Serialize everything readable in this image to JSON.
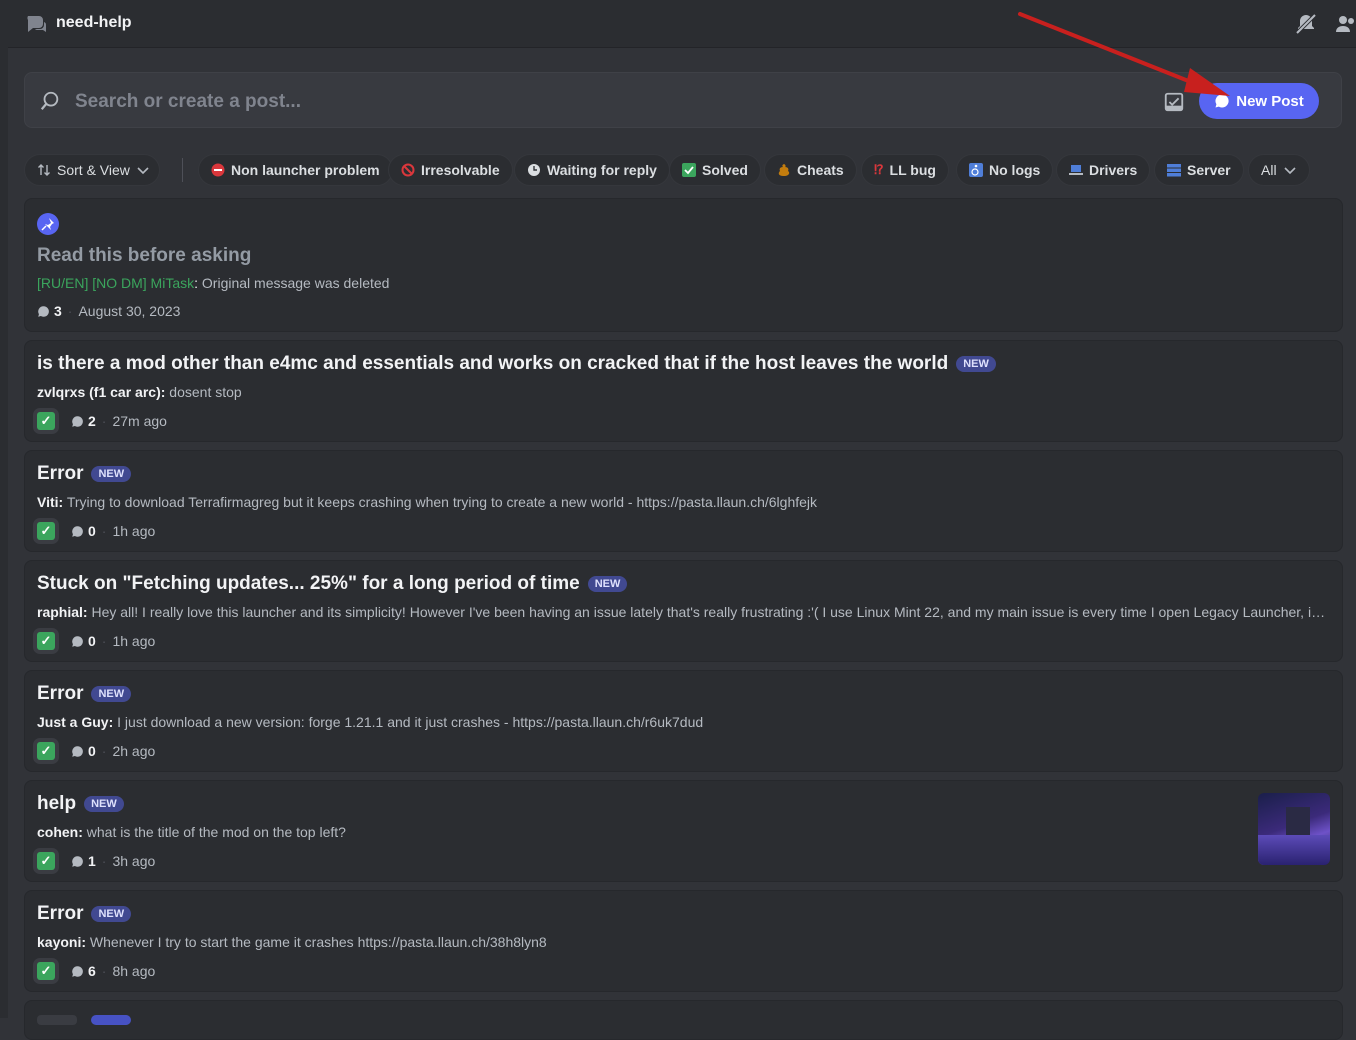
{
  "header": {
    "title": "need-help"
  },
  "search": {
    "placeholder": "Search or create a post...",
    "new_post_label": "New Post"
  },
  "tags": [
    {
      "label": "Sort & View",
      "icon": "sort-icon"
    },
    {
      "label": "Non launcher problem",
      "icon": "no-entry-icon",
      "color": "#da373c"
    },
    {
      "label": "Irresolvable",
      "icon": "prohibited-icon",
      "color": "#da373c"
    },
    {
      "label": "Waiting for reply",
      "icon": "clock-icon",
      "color": "#dbdee1"
    },
    {
      "label": "Solved",
      "icon": "check-icon",
      "color": "#3ba55d"
    },
    {
      "label": "Cheats",
      "icon": "poop-icon",
      "color": "#c27c0e"
    },
    {
      "label": "LL bug",
      "icon": "interrobang-icon",
      "color": "#da373c"
    },
    {
      "label": "No logs",
      "icon": "wheelchair-icon",
      "color": "#4f7ed8"
    },
    {
      "label": "Drivers",
      "icon": "laptop-icon",
      "color": "#4f7ed8"
    },
    {
      "label": "Server",
      "icon": "server-icon",
      "color": "#4f7ed8"
    },
    {
      "label": "All",
      "icon": "chevron-down-icon"
    }
  ],
  "posts": [
    {
      "title": "Read this before asking",
      "new": "",
      "author": "[RU/EN] [NO DM] MiTask",
      "message": "Original message was deleted",
      "replies": "3",
      "time": "August 30, 2023",
      "pinned": true
    },
    {
      "title": "is there a mod other than e4mc and essentials and works on cracked that if the host leaves the world",
      "new": "NEW",
      "author": "zvlqrxs (f1 car arc):",
      "message": "dosent stop",
      "replies": "2",
      "time": "27m ago"
    },
    {
      "title": "Error",
      "new": "NEW",
      "author": "Viti:",
      "message": "Trying to download Terrafirmagreg but it keeps crashing when trying to create a new world - https://pasta.llaun.ch/6lghfejk",
      "replies": "0",
      "time": "1h ago"
    },
    {
      "title": "Stuck on \"Fetching updates... 25%\" for a long period of time",
      "new": "NEW",
      "author": "raphial:",
      "message": "Hey all! I really love this launcher and its simplicity! However I've been having an issue lately that's really frustrating :'( I use Linux Mint 22, and my main issue is every time I open Legacy Launcher, it hangs at ...",
      "replies": "0",
      "time": "1h ago"
    },
    {
      "title": "Error",
      "new": "NEW",
      "author": "Just a Guy:",
      "message": "I just download a new version: forge 1.21.1 and it just crashes - https://pasta.llaun.ch/r6uk7dud",
      "replies": "0",
      "time": "2h ago"
    },
    {
      "title": "help",
      "new": "NEW",
      "author": "cohen:",
      "message": "what is the title of the mod on the top left?",
      "replies": "1",
      "time": "3h ago"
    },
    {
      "title": "Error",
      "new": "NEW",
      "author": "kayoni:",
      "message": "Whenever I try to start the game it crashes https://pasta.llaun.ch/38h8lyn8",
      "replies": "6",
      "time": "8h ago"
    }
  ],
  "colors": {
    "accent": "#5865f2",
    "background": "#313338",
    "card": "#2b2d31",
    "solved": "#3ba55d",
    "annotation_arrow": "#c8201e"
  }
}
